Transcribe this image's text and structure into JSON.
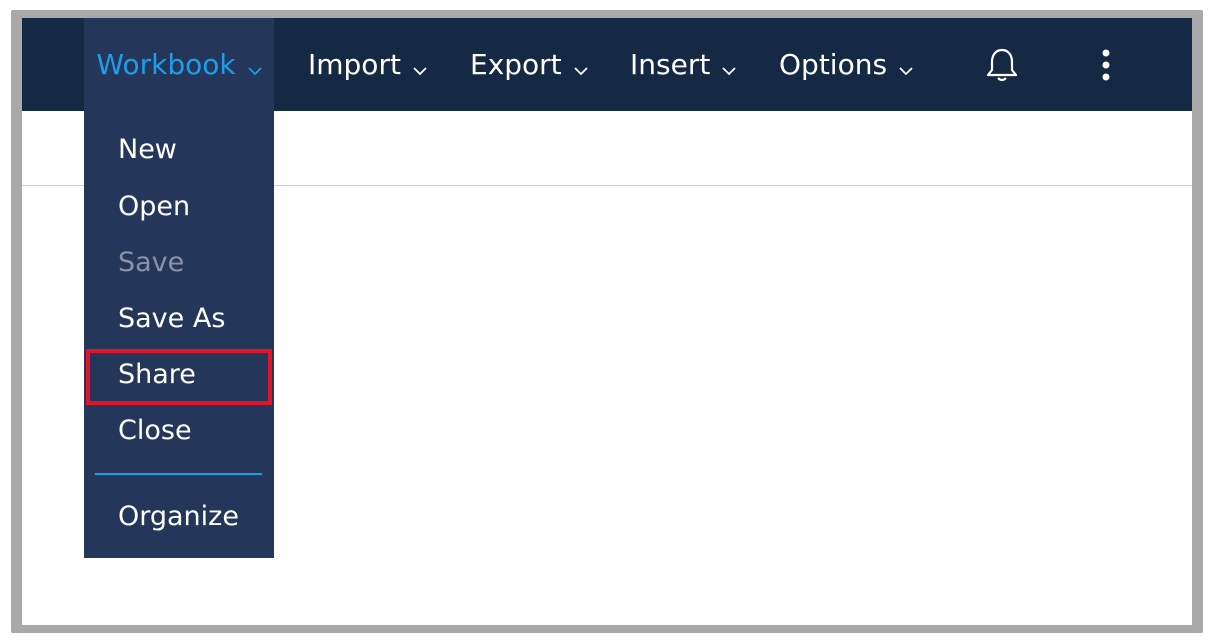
{
  "toolbar": {
    "menus": [
      {
        "label": "Workbook",
        "active": true
      },
      {
        "label": "Import"
      },
      {
        "label": "Export"
      },
      {
        "label": "Insert"
      },
      {
        "label": "Options"
      }
    ],
    "notification_icon": "bell-icon",
    "more_icon": "kebab-vertical-icon"
  },
  "workbook_menu": {
    "items": [
      {
        "label": "New",
        "enabled": true
      },
      {
        "label": "Open",
        "enabled": true
      },
      {
        "label": "Save",
        "enabled": false
      },
      {
        "label": "Save As",
        "enabled": true
      },
      {
        "label": "Share",
        "enabled": true,
        "highlighted": true
      },
      {
        "label": "Close",
        "enabled": true
      },
      {
        "label": "Organize",
        "enabled": true
      }
    ]
  },
  "colors": {
    "topbar_bg": "#152844",
    "dropdown_bg": "#24365a",
    "accent": "#1f9ee8",
    "highlight": "#e3142a",
    "disabled_text": "#8a93a5"
  }
}
